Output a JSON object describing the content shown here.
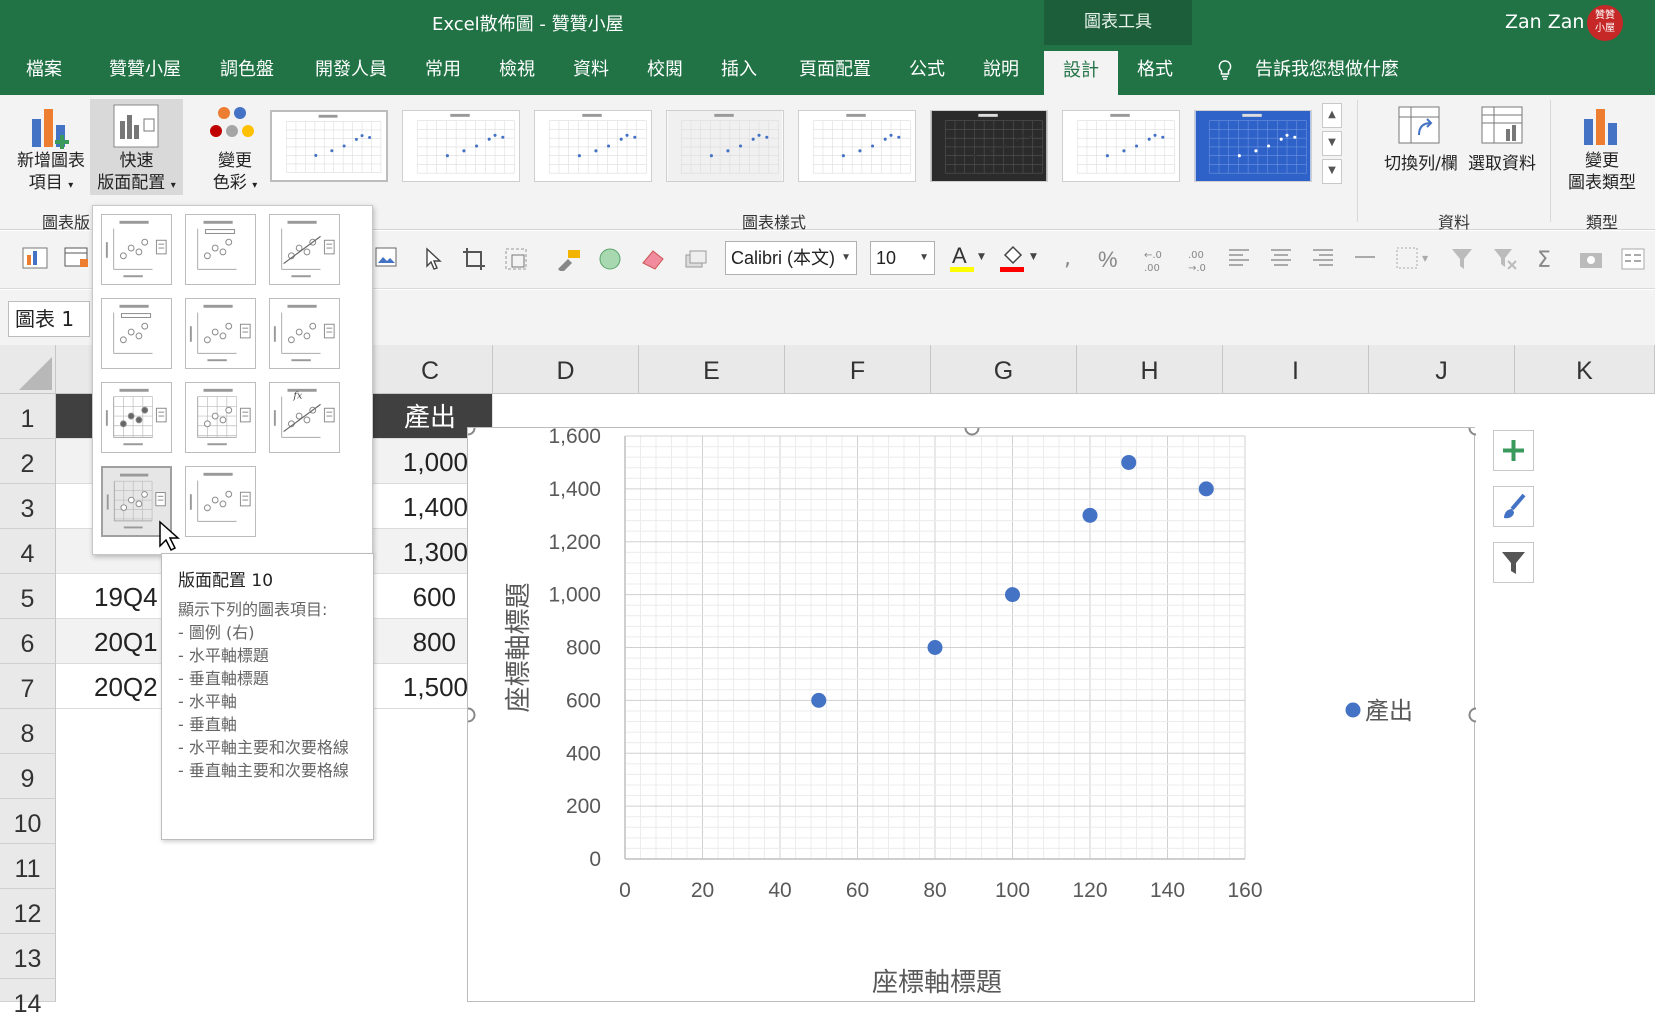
{
  "window": {
    "title": "Excel散佈圖  -  贊贊小屋",
    "context_tools": "圖表工具",
    "user": "Zan Zan",
    "avatar_text": "贊贊小屋"
  },
  "tabs": [
    "檔案",
    "贊贊小屋",
    "調色盤",
    "開發人員",
    "常用",
    "檢視",
    "資料",
    "校閱",
    "插入",
    "頁面配置",
    "公式",
    "說明",
    "設計",
    "格式"
  ],
  "active_tab": "設計",
  "tell_me": "告訴我您想做什麼",
  "ribbon": {
    "add_element": {
      "line1": "新增圖表",
      "line2": "項目"
    },
    "quick_layout": {
      "line1": "快速",
      "line2": "版面配置"
    },
    "change_colors": {
      "line1": "變更",
      "line2": "色彩"
    },
    "switch_row_col": "切換列/欄",
    "select_data": "選取資料",
    "change_type": {
      "line1": "變更",
      "line2": "圖表類型"
    },
    "groups": {
      "layouts": "圖表版",
      "styles": "圖表樣式",
      "data": "資料",
      "type": "類型"
    }
  },
  "format_toolbar": {
    "font": "Calibri (本文)",
    "size": "10"
  },
  "namebox": "圖表 1",
  "columns": [
    "C",
    "D",
    "E",
    "F",
    "G",
    "H",
    "I",
    "J",
    "K"
  ],
  "rows": [
    "1",
    "2",
    "3",
    "4",
    "5",
    "6",
    "7",
    "8",
    "9",
    "10",
    "11",
    "12",
    "13",
    "14"
  ],
  "cells": {
    "header": "產出",
    "values": [
      "1,000",
      "1,400",
      "1,300",
      "600",
      "800",
      "1,500"
    ],
    "labels": [
      "19Q4",
      "20Q1",
      "20Q2"
    ]
  },
  "tooltip": {
    "title": "版面配置 10",
    "body": "顯示下列的圖表項目:\n- 圖例 (右)\n- 水平軸標題\n- 垂直軸標題\n- 水平軸\n- 垂直軸\n- 水平軸主要和次要格線\n- 垂直軸主要和次要格線"
  },
  "colors": {
    "excel_green": "#217346",
    "series": "#4472c4"
  },
  "chart_data": {
    "type": "scatter",
    "xlabel": "座標軸標題",
    "ylabel": "座標軸標題",
    "xlim": [
      0,
      160
    ],
    "ylim": [
      0,
      1600
    ],
    "xticks": [
      "0",
      "20",
      "40",
      "60",
      "80",
      "100",
      "120",
      "140",
      "160"
    ],
    "yticks": [
      "0",
      "200",
      "400",
      "600",
      "800",
      "1,000",
      "1,200",
      "1,400",
      "1,600"
    ],
    "grid": "major and minor",
    "legend": "right",
    "series": [
      {
        "name": "產出",
        "x": [
          50,
          80,
          100,
          120,
          130,
          150
        ],
        "y": [
          600,
          800,
          1000,
          1300,
          1500,
          1400
        ]
      }
    ]
  }
}
